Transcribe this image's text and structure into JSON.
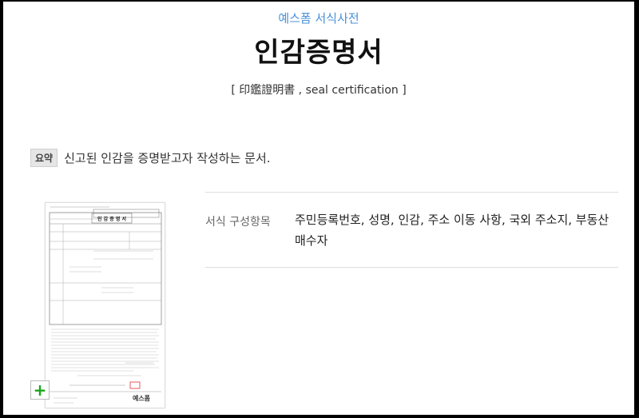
{
  "header": {
    "brand": "예스폼 서식사전",
    "title": "인감증명서",
    "subtitle": "[ 印鑑證明書 , seal certification ]"
  },
  "summary": {
    "badge": "요약",
    "text": "신고된 인감을 증명받고자 작성하는 문서."
  },
  "info": {
    "label": "서식 구성항목",
    "value": "주민등록번호, 성명, 인감, 주소 이동 사항, 국외 주소지, 부동산 매수자"
  },
  "thumbnail": {
    "doc_title": "인 감 증 명 서",
    "logo": "예스폼"
  },
  "colors": {
    "brand": "#4a90d9",
    "zoom_plus": "#1aa41a"
  },
  "icons": {
    "zoom": "plus-icon"
  }
}
